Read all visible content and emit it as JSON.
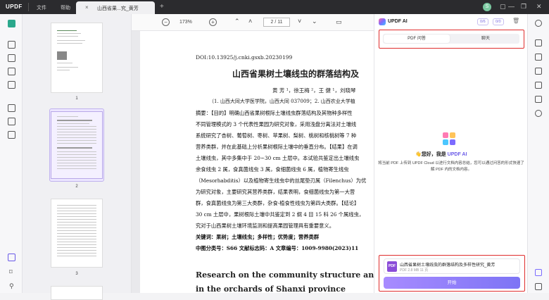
{
  "titlebar": {
    "logo": "UPDF",
    "menu": [
      "文件",
      "帮助"
    ],
    "tab_title": "山西省果...究_黄芳",
    "tab_close": "×",
    "tab_add": "+",
    "avatar_letter": "S"
  },
  "viewer_toolbar": {
    "zoom_out": "−",
    "zoom": "173%",
    "zoom_in": "+",
    "current_page": "2",
    "total_pages": "11",
    "page_display": "2 / 11"
  },
  "thumbnails": [
    {
      "num": "1"
    },
    {
      "num": "2",
      "active": true
    },
    {
      "num": "3"
    }
  ],
  "document": {
    "doi": "DOI:10.13925/j.cnki.gsxb.20230199",
    "title": "山西省果树土壤线虫的群落结构及",
    "authors": "黄  芳 ¹，徐王梅 ²，王  健 ¹，刘晓琴",
    "affiliation": "（1. 山西大同大学医学院，山西大同 037009；2. 山西农业大学植",
    "abstract_lines": [
      "摘要：【目的】明确山西省果树根际土壤线虫群落结构及其物种多样性",
      "不同管理模式的 3 个代表性果园为研究对象，采用浅盘分离法对土壤线",
      "系统研究了杏树、葡萄树、枣树、苹果树、梨树、桃树和核桃树等 7 种",
      "营养类群，并在此基础上分析果树根际土壤中的垂直分布。【结果】在调",
      "土壤线虫，其中多集中于 20~30 cm 土层中。本试验共鉴定出土壤线虫",
      "余食线虫 2 属，食真菌线虫 3 属，食细菌线虫 6 属，植物寄生线虫",
      "（Mesorhabditis）以及植物寄生线虫中的丝尾垫刃属（Filenchus）为优",
      "为研究对象，主要研究其营养类群，结果表明，食细菌线虫为第一大营",
      "群，食真菌线虫为第三大类群，杂食-植食性线虫为第四大类群。【结论】",
      "30 cm 土层中，果树根际土壤中共鉴定到 2 纲 4 目 15 科 26 个属线虫，",
      "究对于山西果树土壤环境监测和提高果园管理具有重要意义。"
    ],
    "keywords": "关键词：果树；土壤线虫；多样性；优势度；营养类群",
    "classification": "中图分类号：S66      文献标志码：A      文章编号：1009-9980(2023)11",
    "english_title_1": "Research on the community structure and dive",
    "english_title_2": "in the orchards of Shanxi province"
  },
  "ai_panel": {
    "title": "UPDF AI",
    "pill_1": "0/6",
    "pill_2": "0/0",
    "tabs": [
      {
        "label": "PDF 问答",
        "active": true
      },
      {
        "label": "聊天",
        "active": false
      }
    ],
    "welcome_prefix": "您好，我是",
    "welcome_brand": "UPDF AI",
    "welcome_desc": "将当前 PDF 上传到 UPDF Cloud 以进行文档内容总结，您可以通过问答的形式快速了解 PDF 内的文档内容。",
    "file_name": "山西省果树土壤线虫的群落结构及多样性研究_黄芳",
    "file_meta": "PDF   2.8 MB   11 页",
    "pdf_badge": "PDF",
    "start_label": "开始"
  }
}
